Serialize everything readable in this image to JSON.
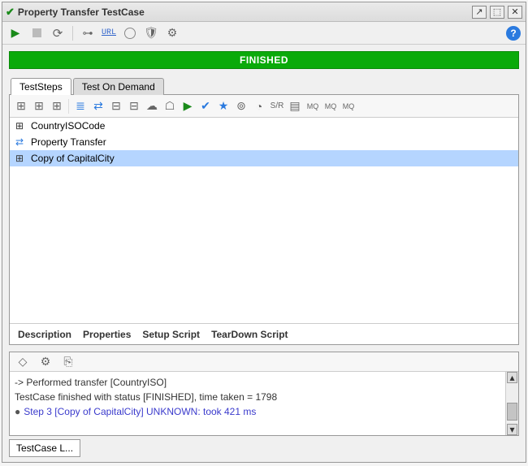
{
  "window": {
    "title": "Property Transfer TestCase",
    "status_icon": "check"
  },
  "status": {
    "label": "FINISHED"
  },
  "tabs": [
    {
      "label": "TestSteps",
      "active": true
    },
    {
      "label": "Test On Demand",
      "active": false
    }
  ],
  "steps": [
    {
      "icon": "soap",
      "label": "CountryISOCode",
      "selected": false
    },
    {
      "icon": "transfer",
      "label": "Property Transfer",
      "selected": false
    },
    {
      "icon": "soap",
      "label": "Copy of CapitalCity",
      "selected": true
    }
  ],
  "sub_tabs": [
    {
      "label": "Description"
    },
    {
      "label": "Properties"
    },
    {
      "label": "Setup Script"
    },
    {
      "label": "TearDown Script"
    }
  ],
  "log": {
    "lines": [
      {
        "text": "-> Performed transfer [CountryISO]",
        "style": "plain"
      },
      {
        "text": "TestCase finished with status [FINISHED], time taken = 1798",
        "style": "plain"
      },
      {
        "text": "Step 3 [Copy of CapitalCity] UNKNOWN: took 421 ms",
        "style": "link",
        "bullet": true
      }
    ]
  },
  "footer_tab": "TestCase L...",
  "toolbar_url_label": "URL"
}
